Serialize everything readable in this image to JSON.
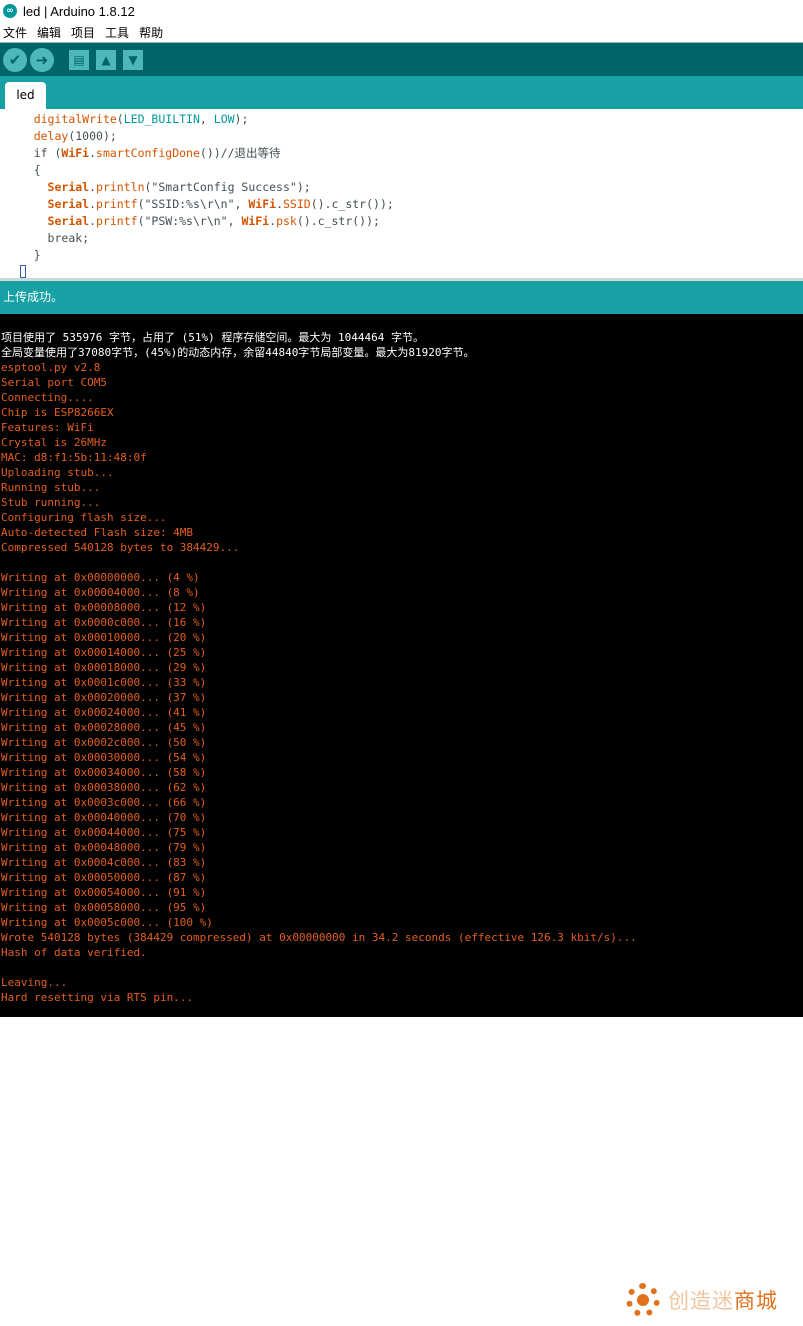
{
  "window": {
    "title": "led | Arduino 1.8.12",
    "logo": "∞"
  },
  "menu": [
    "文件",
    "编辑",
    "项目",
    "工具",
    "帮助"
  ],
  "toolbar": {
    "verify_glyph": "✔",
    "upload_glyph": "➜",
    "new_glyph": "▤",
    "open_glyph": "▲",
    "save_glyph": "▼"
  },
  "tabs": [
    {
      "label": "led"
    }
  ],
  "editor": {
    "lines": [
      {
        "indent": "    ",
        "parts": [
          [
            "fn",
            "digitalWrite"
          ],
          [
            "p",
            "("
          ],
          [
            "const",
            "LED_BUILTIN"
          ],
          [
            "p",
            ", "
          ],
          [
            "const",
            "LOW"
          ],
          [
            "p",
            ");"
          ]
        ]
      },
      {
        "indent": "    ",
        "parts": [
          [
            "fn",
            "delay"
          ],
          [
            "p",
            "(1000);"
          ]
        ]
      },
      {
        "indent": "    ",
        "parts": [
          [
            "p",
            "if ("
          ],
          [
            "obj",
            "WiFi"
          ],
          [
            "p",
            "."
          ],
          [
            "fn",
            "smartConfigDone"
          ],
          [
            "p",
            "())//退出等待"
          ]
        ]
      },
      {
        "indent": "    ",
        "parts": [
          [
            "p",
            "{"
          ]
        ]
      },
      {
        "indent": "      ",
        "parts": [
          [
            "obj",
            "Serial"
          ],
          [
            "p",
            "."
          ],
          [
            "fn",
            "println"
          ],
          [
            "p",
            "(\"SmartConfig Success\");"
          ]
        ]
      },
      {
        "indent": "      ",
        "parts": [
          [
            "obj",
            "Serial"
          ],
          [
            "p",
            "."
          ],
          [
            "fn",
            "printf"
          ],
          [
            "p",
            "(\"SSID:%s\\r\\n\", "
          ],
          [
            "obj",
            "WiFi"
          ],
          [
            "p",
            "."
          ],
          [
            "fn",
            "SSID"
          ],
          [
            "p",
            "().c_str());"
          ]
        ]
      },
      {
        "indent": "      ",
        "parts": [
          [
            "obj",
            "Serial"
          ],
          [
            "p",
            "."
          ],
          [
            "fn",
            "printf"
          ],
          [
            "p",
            "(\"PSW:%s\\r\\n\", "
          ],
          [
            "obj",
            "WiFi"
          ],
          [
            "p",
            "."
          ],
          [
            "fn",
            "psk"
          ],
          [
            "p",
            "().c_str());"
          ]
        ]
      },
      {
        "indent": "      ",
        "parts": [
          [
            "p",
            "break;"
          ]
        ]
      },
      {
        "indent": "    ",
        "parts": [
          [
            "p",
            "}"
          ]
        ]
      }
    ],
    "cursor_char": "}"
  },
  "status": {
    "message": "上传成功。"
  },
  "console": {
    "lines": [
      {
        "color": "white",
        "text": "项目使用了 535976 字节，占用了 (51%) 程序存储空间。最大为 1044464 字节。"
      },
      {
        "color": "white",
        "text": "全局变量使用了37080字节，(45%)的动态内存，余留44840字节局部变量。最大为81920字节。"
      },
      {
        "color": "orange",
        "text": "esptool.py v2.8"
      },
      {
        "color": "orange",
        "text": "Serial port COM5"
      },
      {
        "color": "orange",
        "text": "Connecting...."
      },
      {
        "color": "orange",
        "text": "Chip is ESP8266EX"
      },
      {
        "color": "orange",
        "text": "Features: WiFi"
      },
      {
        "color": "orange",
        "text": "Crystal is 26MHz"
      },
      {
        "color": "orange",
        "text": "MAC: d8:f1:5b:11:48:0f"
      },
      {
        "color": "orange",
        "text": "Uploading stub..."
      },
      {
        "color": "orange",
        "text": "Running stub..."
      },
      {
        "color": "orange",
        "text": "Stub running..."
      },
      {
        "color": "orange",
        "text": "Configuring flash size..."
      },
      {
        "color": "orange",
        "text": "Auto-detected Flash size: 4MB"
      },
      {
        "color": "orange",
        "text": "Compressed 540128 bytes to 384429..."
      },
      {
        "color": "orange",
        "text": ""
      },
      {
        "color": "orange",
        "text": "Writing at 0x00000000... (4 %)"
      },
      {
        "color": "orange",
        "text": "Writing at 0x00004000... (8 %)"
      },
      {
        "color": "orange",
        "text": "Writing at 0x00008000... (12 %)"
      },
      {
        "color": "orange",
        "text": "Writing at 0x0000c000... (16 %)"
      },
      {
        "color": "orange",
        "text": "Writing at 0x00010000... (20 %)"
      },
      {
        "color": "orange",
        "text": "Writing at 0x00014000... (25 %)"
      },
      {
        "color": "orange",
        "text": "Writing at 0x00018000... (29 %)"
      },
      {
        "color": "orange",
        "text": "Writing at 0x0001c000... (33 %)"
      },
      {
        "color": "orange",
        "text": "Writing at 0x00020000... (37 %)"
      },
      {
        "color": "orange",
        "text": "Writing at 0x00024000... (41 %)"
      },
      {
        "color": "orange",
        "text": "Writing at 0x00028000... (45 %)"
      },
      {
        "color": "orange",
        "text": "Writing at 0x0002c000... (50 %)"
      },
      {
        "color": "orange",
        "text": "Writing at 0x00030000... (54 %)"
      },
      {
        "color": "orange",
        "text": "Writing at 0x00034000... (58 %)"
      },
      {
        "color": "orange",
        "text": "Writing at 0x00038000... (62 %)"
      },
      {
        "color": "orange",
        "text": "Writing at 0x0003c000... (66 %)"
      },
      {
        "color": "orange",
        "text": "Writing at 0x00040000... (70 %)"
      },
      {
        "color": "orange",
        "text": "Writing at 0x00044000... (75 %)"
      },
      {
        "color": "orange",
        "text": "Writing at 0x00048000... (79 %)"
      },
      {
        "color": "orange",
        "text": "Writing at 0x0004c000... (83 %)"
      },
      {
        "color": "orange",
        "text": "Writing at 0x00050000... (87 %)"
      },
      {
        "color": "orange",
        "text": "Writing at 0x00054000... (91 %)"
      },
      {
        "color": "orange",
        "text": "Writing at 0x00058000... (95 %)"
      },
      {
        "color": "orange",
        "text": "Writing at 0x0005c000... (100 %)"
      },
      {
        "color": "orange",
        "text": "Wrote 540128 bytes (384429 compressed) at 0x00000000 in 34.2 seconds (effective 126.3 kbit/s)..."
      },
      {
        "color": "orange",
        "text": "Hash of data verified."
      },
      {
        "color": "orange",
        "text": ""
      },
      {
        "color": "orange",
        "text": "Leaving..."
      },
      {
        "color": "orange",
        "text": "Hard resetting via RTS pin..."
      }
    ]
  },
  "watermark": {
    "text_light": "创造迷",
    "text_strong": "商城"
  },
  "colors": {
    "toolbar": "#006468",
    "tabbar": "#17a1a5",
    "console_bg": "#000000",
    "console_text": "#e45f1f",
    "keyword_fn": "#d35400",
    "keyword_const": "#00979c"
  }
}
